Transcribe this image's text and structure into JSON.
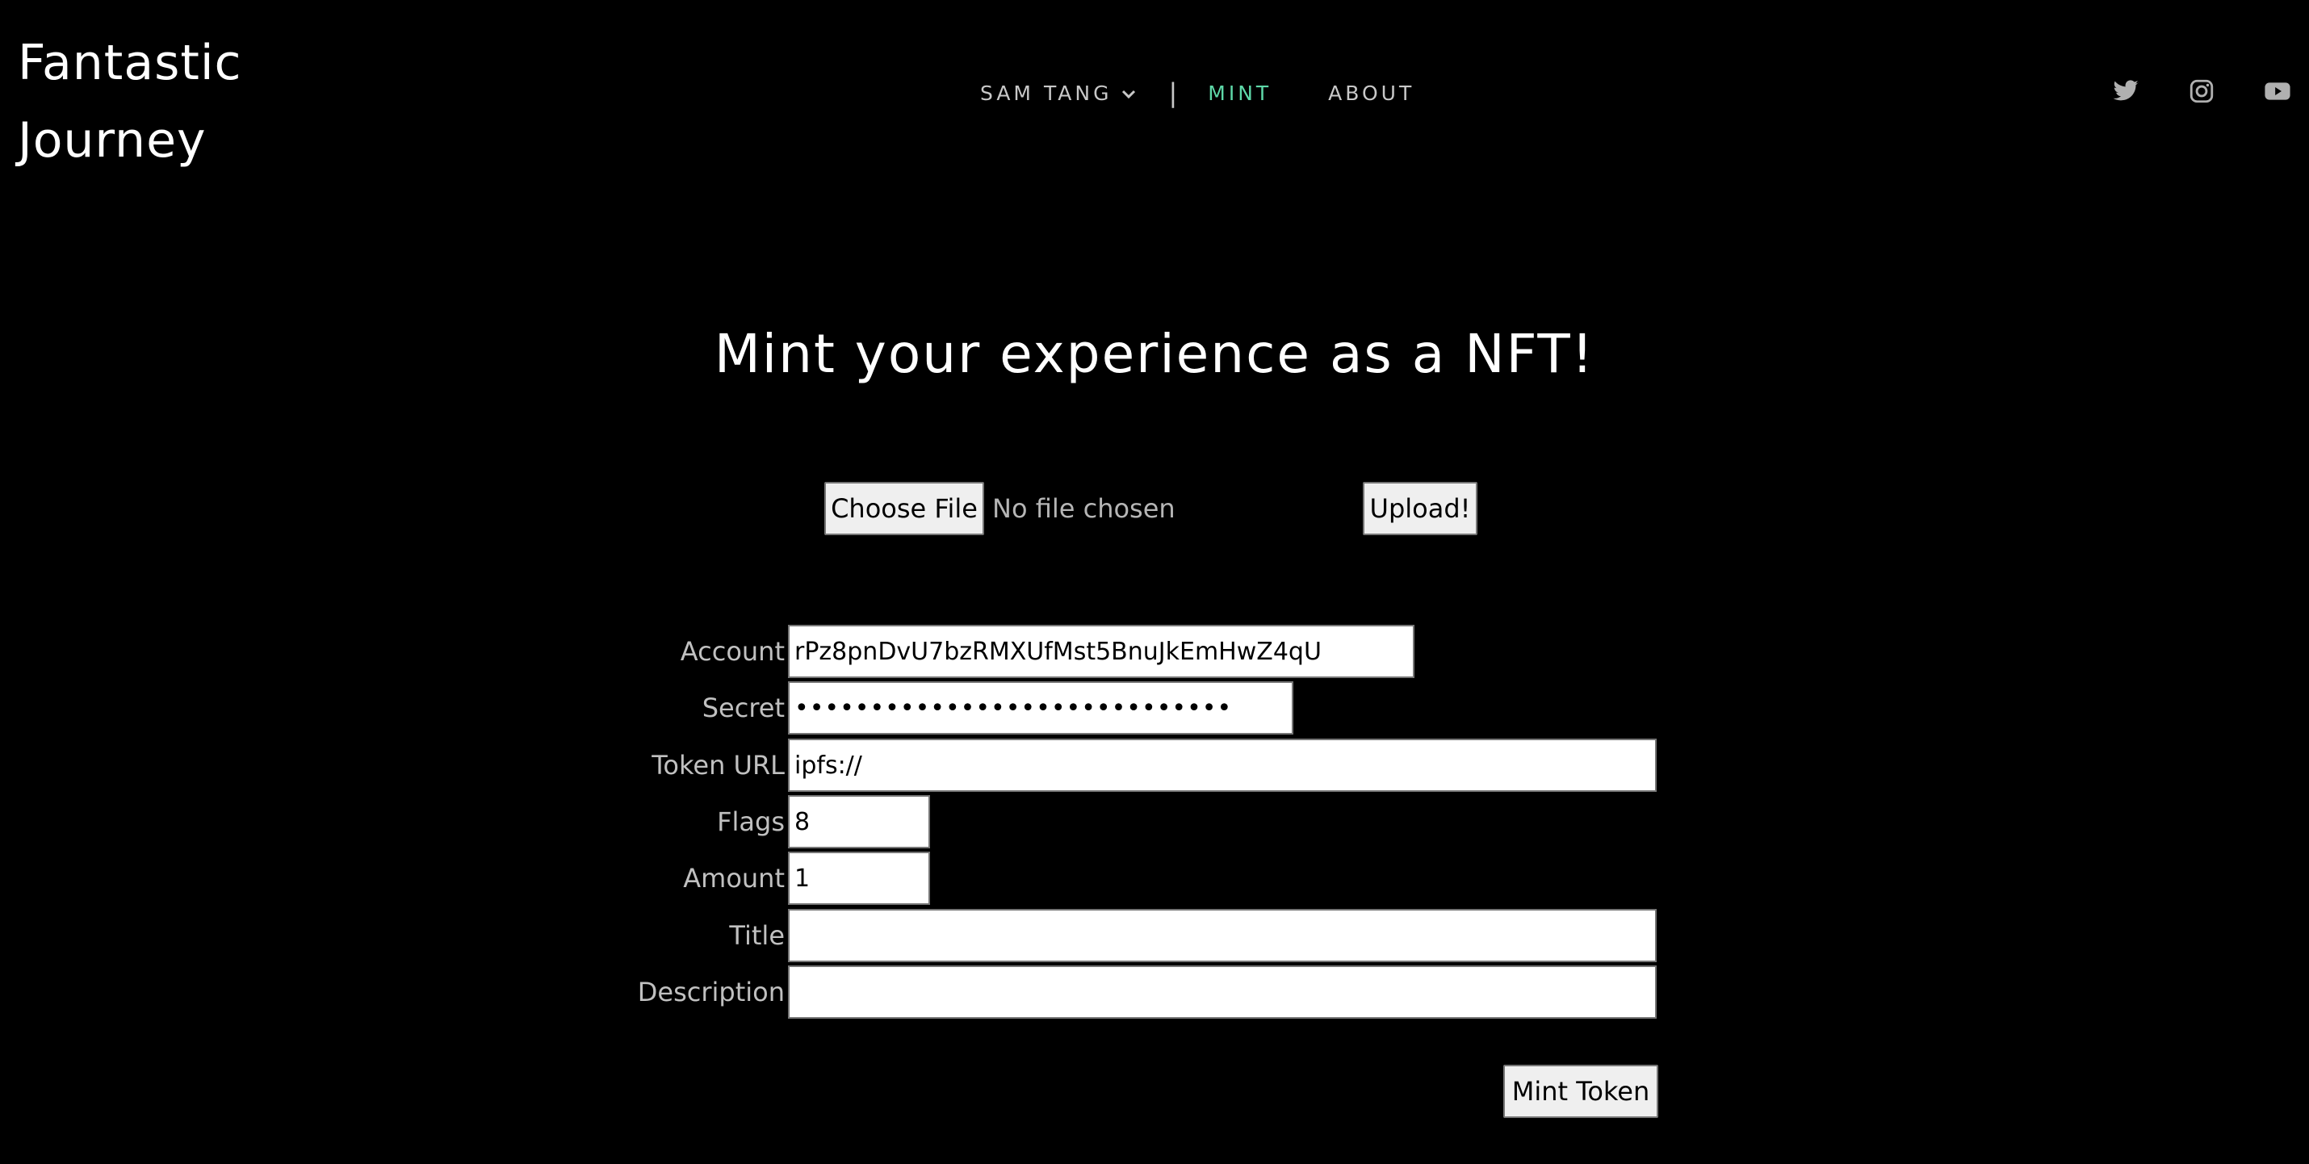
{
  "header": {
    "site_title_line1": "Fantastic",
    "site_title_line2": "Journey"
  },
  "nav": {
    "items": [
      {
        "label": "SAM TANG",
        "has_dropdown": true
      },
      {
        "label": "MINT",
        "active": true
      },
      {
        "label": "ABOUT"
      }
    ],
    "separator": "|",
    "active_color": "#5ed8a8"
  },
  "social": {
    "icons": [
      "twitter-icon",
      "instagram-icon",
      "youtube-icon"
    ]
  },
  "main": {
    "title": "Mint your experience as a NFT!"
  },
  "upload": {
    "choose_file_label": "Choose File",
    "file_status": "No file chosen",
    "upload_label": "Upload!"
  },
  "form": {
    "account_label": "Account",
    "account_value": "rPz8pnDvU7bzRMXUfMst5BnuJkEmHwZ4qU",
    "secret_label": "Secret",
    "secret_value": "•••••••••••••••••••••••••••••",
    "token_url_label": "Token URL",
    "token_url_value": "ipfs://",
    "flags_label": "Flags",
    "flags_value": "8",
    "amount_label": "Amount",
    "amount_value": "1",
    "title_label": "Title",
    "title_value": "",
    "description_label": "Description",
    "description_value": "",
    "submit_label": "Mint Token"
  }
}
